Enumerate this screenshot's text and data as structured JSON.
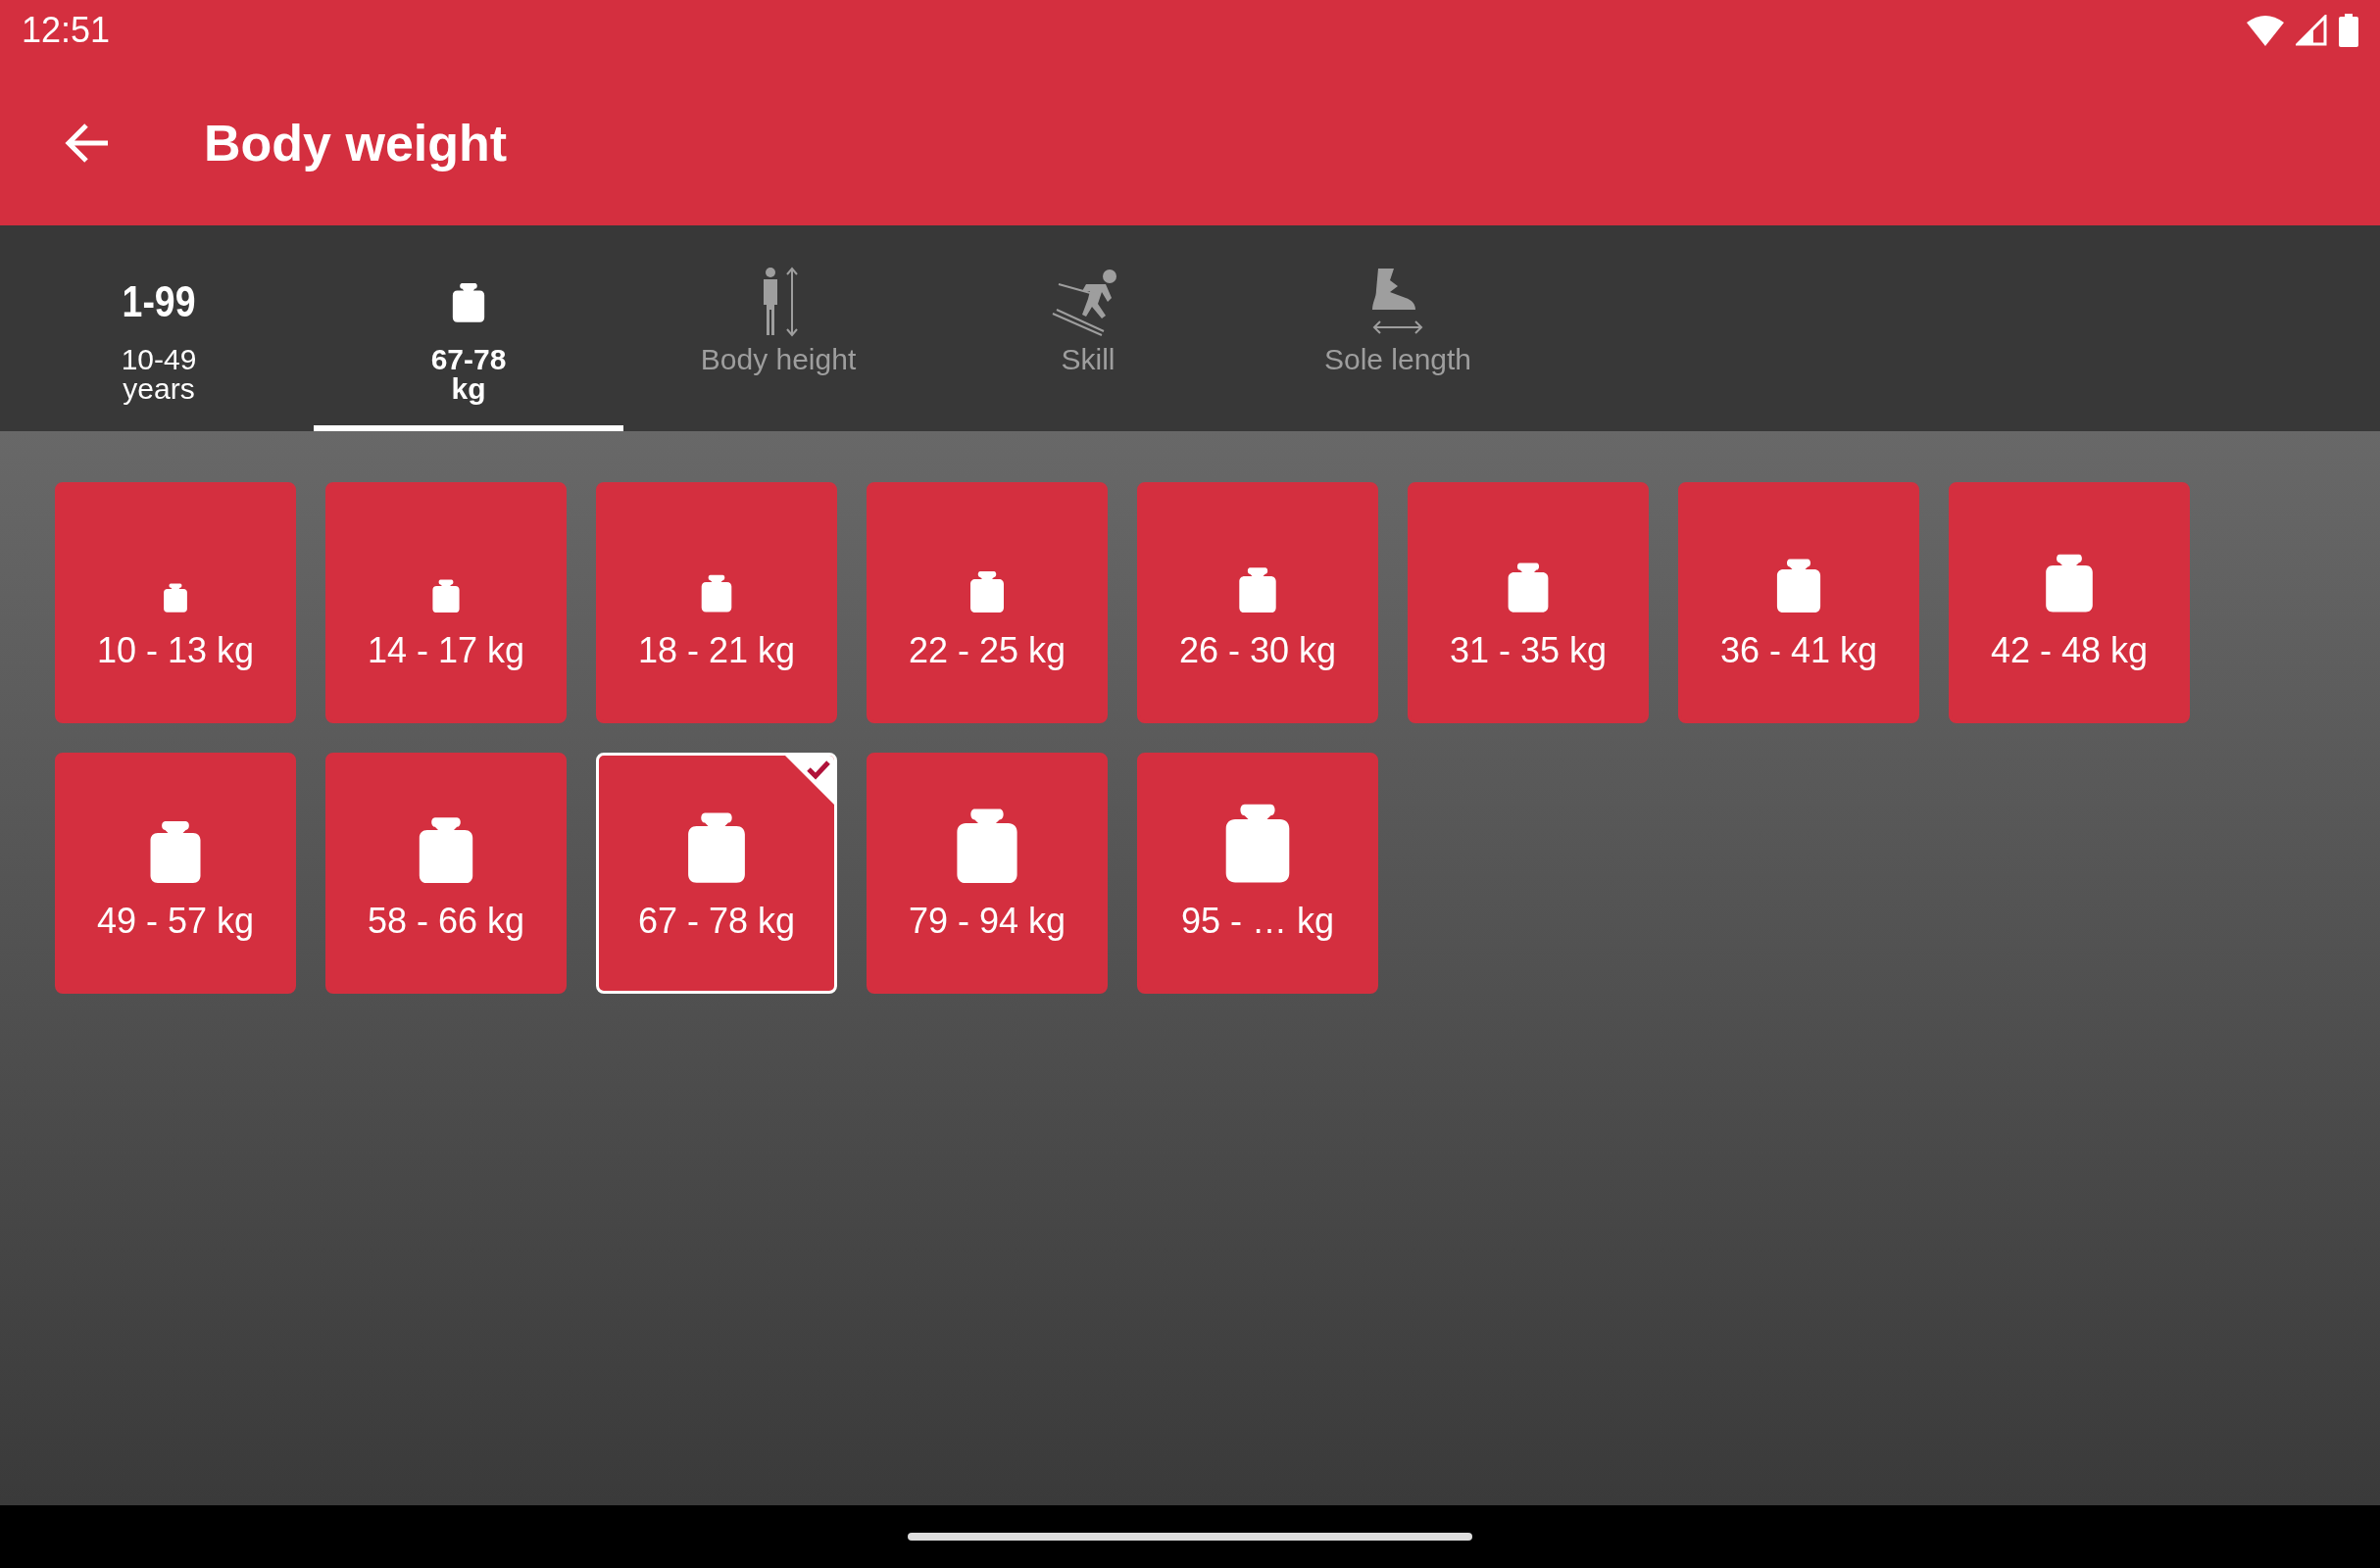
{
  "status_bar": {
    "time": "12:51"
  },
  "app_bar": {
    "title": "Body weight"
  },
  "tabs": [
    {
      "kind": "number",
      "top_text": "1-99",
      "label": "10-49\nyears",
      "done": true,
      "selected": false
    },
    {
      "kind": "weight",
      "label": "67-78\nkg",
      "done": true,
      "selected": true
    },
    {
      "kind": "height",
      "label": "Body height",
      "done": false,
      "selected": false
    },
    {
      "kind": "skill",
      "label": "Skill",
      "done": false,
      "selected": false
    },
    {
      "kind": "sole",
      "label": "Sole length",
      "done": false,
      "selected": false
    }
  ],
  "options": [
    {
      "label": "10 - 13 kg",
      "selected": false
    },
    {
      "label": "14 - 17 kg",
      "selected": false
    },
    {
      "label": "18 - 21 kg",
      "selected": false
    },
    {
      "label": "22 - 25 kg",
      "selected": false
    },
    {
      "label": "26 - 30 kg",
      "selected": false
    },
    {
      "label": "31 - 35 kg",
      "selected": false
    },
    {
      "label": "36 - 41 kg",
      "selected": false
    },
    {
      "label": "42 - 48 kg",
      "selected": false
    },
    {
      "label": "49 - 57 kg",
      "selected": false
    },
    {
      "label": "58 - 66 kg",
      "selected": false
    },
    {
      "label": "67 - 78 kg",
      "selected": true
    },
    {
      "label": "79 - 94 kg",
      "selected": false
    },
    {
      "label": "95 - … kg",
      "selected": false
    }
  ]
}
